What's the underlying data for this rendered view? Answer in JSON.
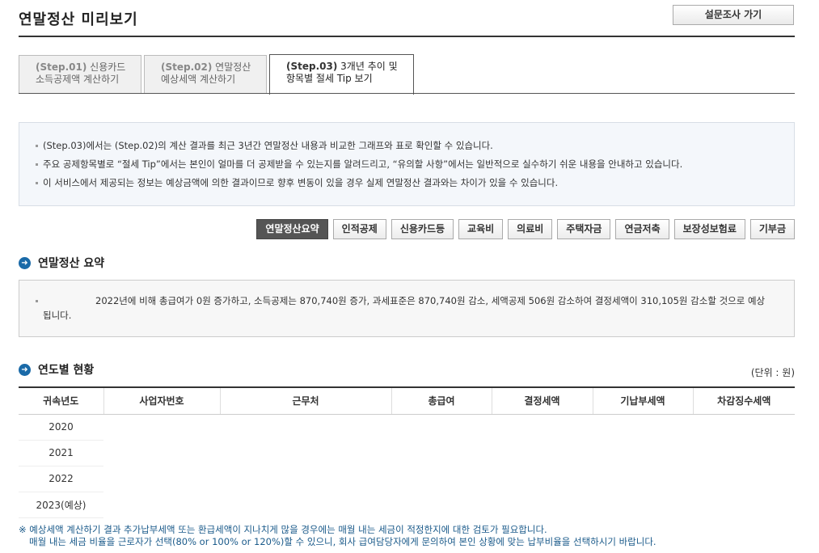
{
  "header": {
    "title": "연말정산 미리보기",
    "survey_button": "설문조사 가기"
  },
  "tabs": [
    {
      "step": "(Step.01)",
      "line1": "신용카드",
      "line2": "소득공제액 계산하기",
      "active": false
    },
    {
      "step": "(Step.02)",
      "line1": "연말정산",
      "line2": "예상세액 계산하기",
      "active": false
    },
    {
      "step": "(Step.03)",
      "line1": "3개년 추이 및",
      "line2": "항목별 절세 Tip 보기",
      "active": true
    }
  ],
  "info": [
    "(Step.03)에서는 (Step.02)의 계산 결과를 최근 3년간 연말정산 내용과 비교한 그래프와 표로 확인할 수 있습니다.",
    "주요 공제항목별로 “절세 Tip”에서는 본인이 얼마를 더 공제받을 수 있는지를 알려드리고, “유의할 사항”에서는 일반적으로 실수하기 쉬운 내용을 안내하고 있습니다.",
    "이 서비스에서 제공되는 정보는 예상금액에 의한 결과이므로 향후 변동이 있을 경우 실제 연말정산 결과와는 차이가 있을 수 있습니다."
  ],
  "categories": [
    "연말정산요약",
    "인적공제",
    "신용카드등",
    "교육비",
    "의료비",
    "주택자금",
    "연금저축",
    "보장성보험료",
    "기부금"
  ],
  "summary": {
    "heading": "연말정산 요약",
    "text": "2022년에 비해 총급여가 0원 증가하고, 소득공제는 870,740원 증가, 과세표준은 870,740원 감소, 세액공제 506원 감소하여 결정세액이 310,105원 감소할 것으로 예상됩니다."
  },
  "yearly": {
    "heading": "연도별 현황",
    "unit": "(단위 : 원)",
    "columns": [
      "귀속년도",
      "사업자번호",
      "근무처",
      "총급여",
      "결정세액",
      "기납부세액",
      "차감징수세액"
    ],
    "rows": [
      "2020",
      "2021",
      "2022",
      "2023(예상)"
    ]
  },
  "notes": {
    "line1": "※ 예상세액 계산하기 결과 추가납부세액 또는 환급세액이 지나치게 많을 경우에는 매월 내는 세금이 적정한지에 대한 검토가 필요합니다.",
    "line2": "매월 내는 세금 비율을 근로자가 선택(80% or 100% or 120%)할 수 있으니, 회사 급여담당자에게 문의하여 본인 상황에 맞는 납부비율을 선택하시기 바랍니다."
  }
}
